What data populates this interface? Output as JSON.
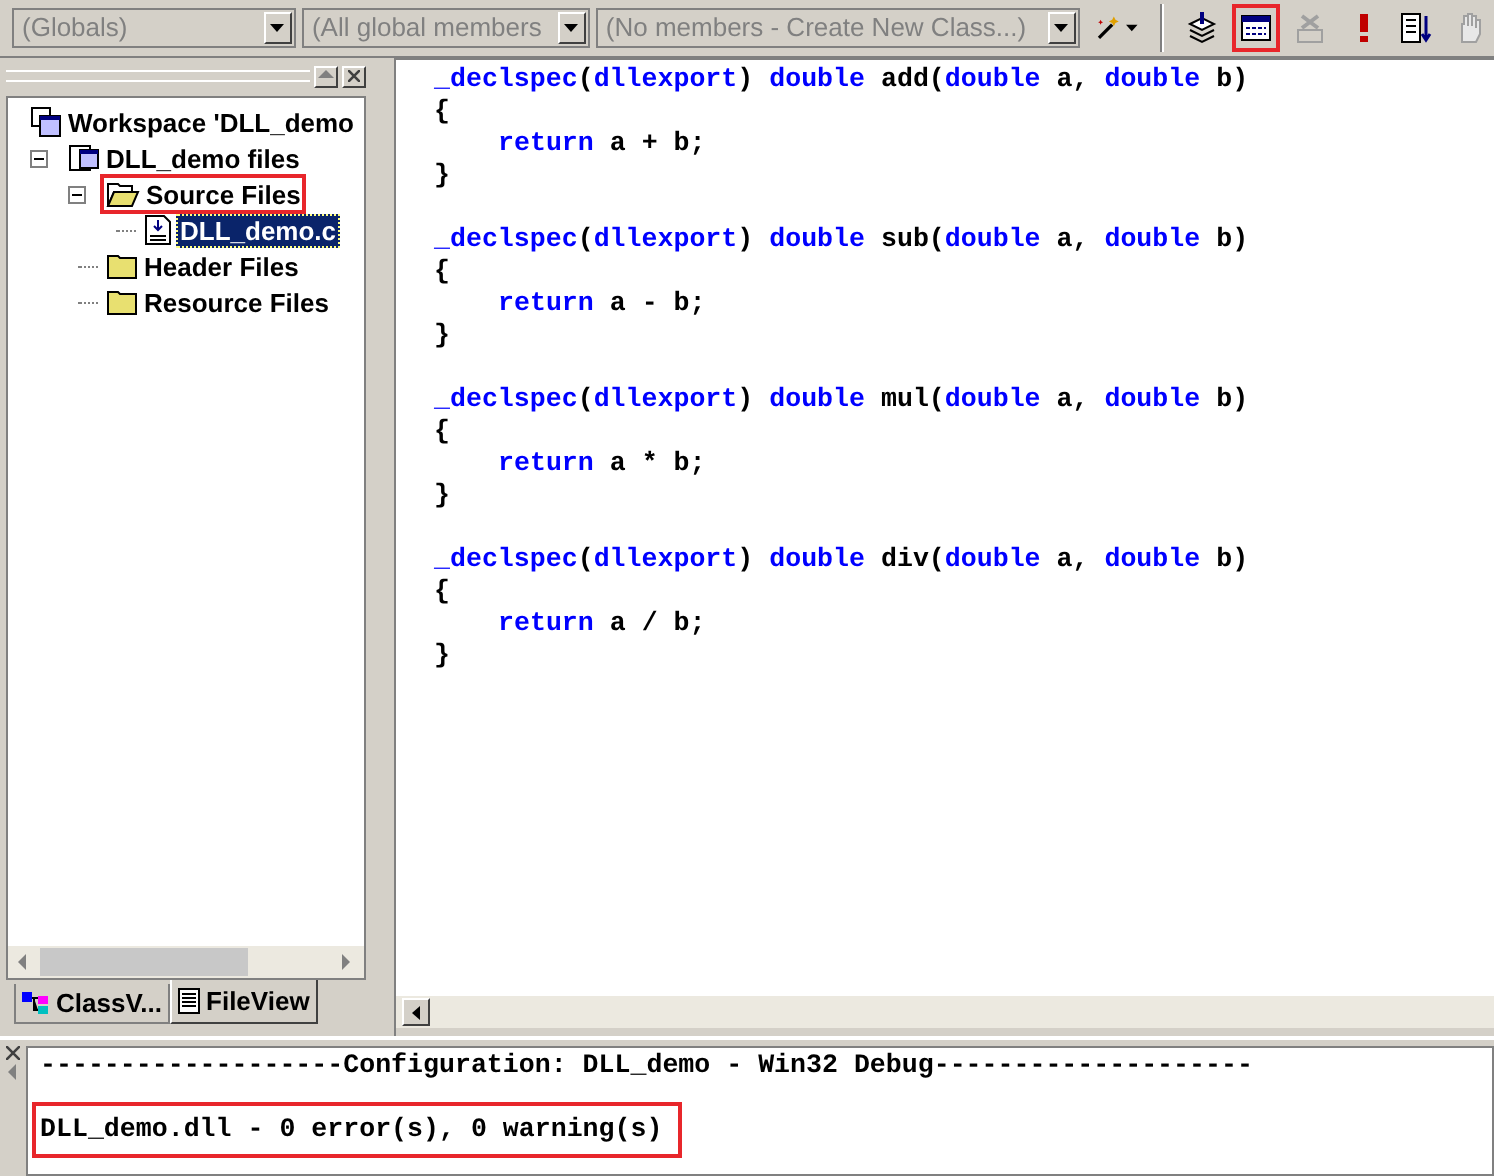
{
  "toolbar": {
    "combos": [
      {
        "value": "(Globals)"
      },
      {
        "value": "(All global members"
      },
      {
        "value": "(No members - Create New Class...)"
      }
    ],
    "buttons": [
      {
        "kind": "wizard",
        "disabled": false,
        "highlighted": false
      },
      {
        "kind": "compile",
        "disabled": false,
        "highlighted": false
      },
      {
        "kind": "build",
        "disabled": false,
        "highlighted": true
      },
      {
        "kind": "stop",
        "disabled": true,
        "highlighted": false
      },
      {
        "kind": "execute",
        "disabled": false,
        "highlighted": false
      },
      {
        "kind": "breakpoint",
        "disabled": false,
        "highlighted": false
      },
      {
        "kind": "hand",
        "disabled": true,
        "highlighted": false
      }
    ]
  },
  "workspace": {
    "tree": [
      {
        "label": "Workspace 'DLL_demo",
        "kind": "workspace",
        "selected": false,
        "highlighted": false,
        "children": [
          {
            "label": "DLL_demo files",
            "kind": "project",
            "selected": false,
            "highlighted": false,
            "expanded": true,
            "children": [
              {
                "label": "Source Files",
                "kind": "folder",
                "selected": false,
                "highlighted": true,
                "expanded": true,
                "children": [
                  {
                    "label": "DLL_demo.c",
                    "kind": "file",
                    "selected": true,
                    "highlighted": false
                  }
                ]
              },
              {
                "label": "Header Files",
                "kind": "folder",
                "selected": false,
                "highlighted": false,
                "expanded": false
              },
              {
                "label": "Resource Files",
                "kind": "folder",
                "selected": false,
                "highlighted": false,
                "expanded": false
              }
            ]
          }
        ]
      }
    ],
    "tabs": [
      {
        "label": "ClassV...",
        "kind": "class",
        "selected": false
      },
      {
        "label": "FileView",
        "kind": "file",
        "selected": true
      }
    ]
  },
  "code": [
    {
      "lines": [
        {
          "kind": "head",
          "tokens": [
            {
              "text": "_declspec",
              "kind": "keyword"
            },
            {
              "text": "(",
              "kind": "plain"
            },
            {
              "text": "dllexport",
              "kind": "keyword"
            },
            {
              "text": ") ",
              "kind": "plain"
            },
            {
              "text": "double",
              "kind": "keyword"
            },
            {
              "text": " add(",
              "kind": "plain"
            },
            {
              "text": "double",
              "kind": "keyword"
            },
            {
              "text": " a, ",
              "kind": "plain"
            },
            {
              "text": "double",
              "kind": "keyword"
            },
            {
              "text": " b)",
              "kind": "plain"
            }
          ]
        },
        {
          "kind": "head",
          "tokens": [
            {
              "text": "{",
              "kind": "plain"
            }
          ]
        },
        {
          "kind": "body",
          "tokens": [
            {
              "text": "return",
              "kind": "keyword"
            },
            {
              "text": " a + b;",
              "kind": "plain"
            }
          ]
        },
        {
          "kind": "head",
          "tokens": [
            {
              "text": "}",
              "kind": "plain"
            }
          ]
        }
      ]
    },
    {
      "lines": [
        {
          "kind": "head",
          "tokens": [
            {
              "text": "_declspec",
              "kind": "keyword"
            },
            {
              "text": "(",
              "kind": "plain"
            },
            {
              "text": "dllexport",
              "kind": "keyword"
            },
            {
              "text": ") ",
              "kind": "plain"
            },
            {
              "text": "double",
              "kind": "keyword"
            },
            {
              "text": " sub(",
              "kind": "plain"
            },
            {
              "text": "double",
              "kind": "keyword"
            },
            {
              "text": " a, ",
              "kind": "plain"
            },
            {
              "text": "double",
              "kind": "keyword"
            },
            {
              "text": " b)",
              "kind": "plain"
            }
          ]
        },
        {
          "kind": "head",
          "tokens": [
            {
              "text": "{",
              "kind": "plain"
            }
          ]
        },
        {
          "kind": "body",
          "tokens": [
            {
              "text": "return",
              "kind": "keyword"
            },
            {
              "text": " a - b;",
              "kind": "plain"
            }
          ]
        },
        {
          "kind": "head",
          "tokens": [
            {
              "text": "}",
              "kind": "plain"
            }
          ]
        }
      ]
    },
    {
      "lines": [
        {
          "kind": "head",
          "tokens": [
            {
              "text": "_declspec",
              "kind": "keyword"
            },
            {
              "text": "(",
              "kind": "plain"
            },
            {
              "text": "dllexport",
              "kind": "keyword"
            },
            {
              "text": ") ",
              "kind": "plain"
            },
            {
              "text": "double",
              "kind": "keyword"
            },
            {
              "text": " mul(",
              "kind": "plain"
            },
            {
              "text": "double",
              "kind": "keyword"
            },
            {
              "text": " a, ",
              "kind": "plain"
            },
            {
              "text": "double",
              "kind": "keyword"
            },
            {
              "text": " b)",
              "kind": "plain"
            }
          ]
        },
        {
          "kind": "head",
          "tokens": [
            {
              "text": "{",
              "kind": "plain"
            }
          ]
        },
        {
          "kind": "body",
          "tokens": [
            {
              "text": "return",
              "kind": "keyword"
            },
            {
              "text": " a * b;",
              "kind": "plain"
            }
          ]
        },
        {
          "kind": "head",
          "tokens": [
            {
              "text": "}",
              "kind": "plain"
            }
          ]
        }
      ]
    },
    {
      "lines": [
        {
          "kind": "head",
          "tokens": [
            {
              "text": "_declspec",
              "kind": "keyword"
            },
            {
              "text": "(",
              "kind": "plain"
            },
            {
              "text": "dllexport",
              "kind": "keyword"
            },
            {
              "text": ") ",
              "kind": "plain"
            },
            {
              "text": "double",
              "kind": "keyword"
            },
            {
              "text": " div(",
              "kind": "plain"
            },
            {
              "text": "double",
              "kind": "keyword"
            },
            {
              "text": " a, ",
              "kind": "plain"
            },
            {
              "text": "double",
              "kind": "keyword"
            },
            {
              "text": " b)",
              "kind": "plain"
            }
          ]
        },
        {
          "kind": "head",
          "tokens": [
            {
              "text": "{",
              "kind": "plain"
            }
          ]
        },
        {
          "kind": "body",
          "tokens": [
            {
              "text": "return",
              "kind": "keyword"
            },
            {
              "text": " a / b;",
              "kind": "plain"
            }
          ]
        },
        {
          "kind": "head",
          "tokens": [
            {
              "text": "}",
              "kind": "plain"
            }
          ]
        }
      ]
    }
  ],
  "output": {
    "lines": [
      {
        "text": "-------------------Configuration: DLL_demo - Win32 Debug--------------------",
        "highlighted": false
      },
      {
        "text": "DLL_demo.dll - 0 error(s), 0 warning(s)",
        "highlighted": true
      }
    ]
  }
}
